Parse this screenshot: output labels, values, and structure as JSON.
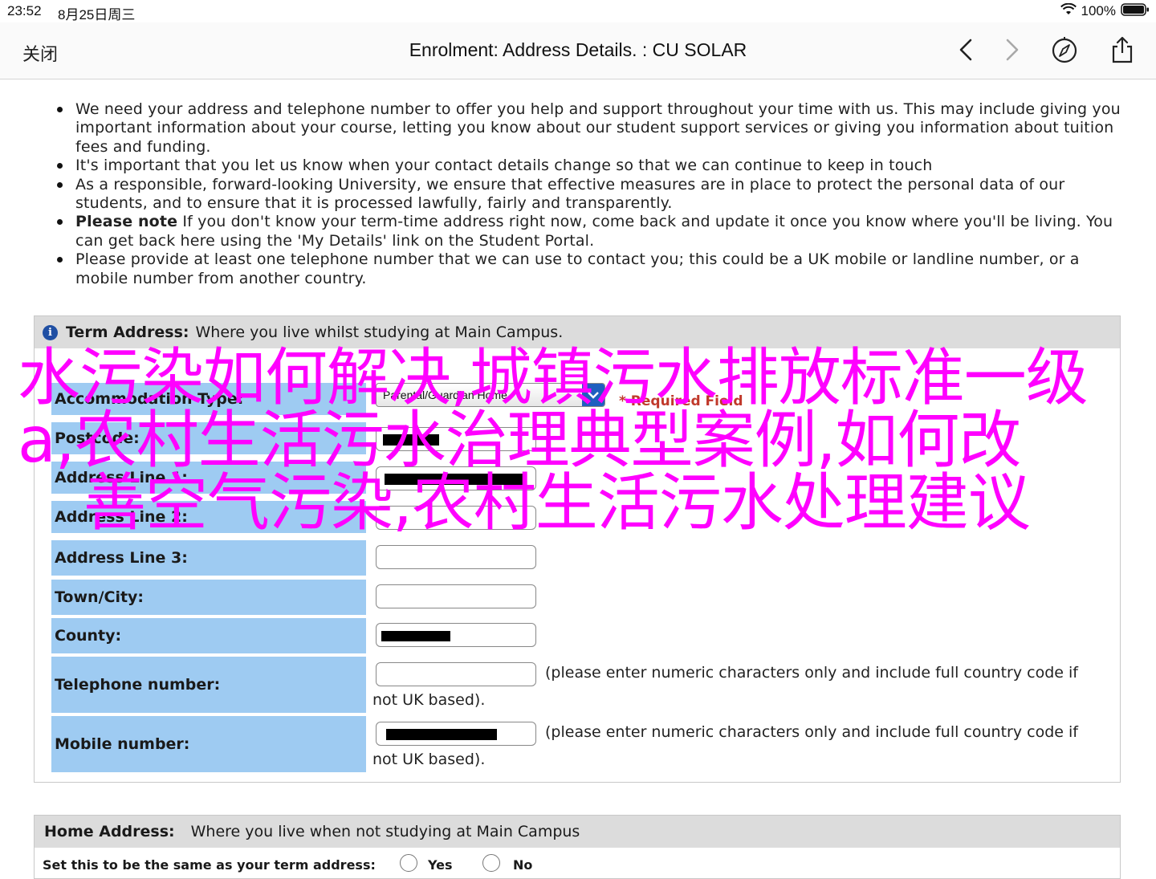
{
  "status_bar": {
    "time": "23:52",
    "date": "8月25日周三",
    "battery": "100%"
  },
  "nav": {
    "close_label": "关闭",
    "title": "Enrolment: Address Details. : CU SOLAR"
  },
  "bullets": [
    {
      "bold": "",
      "text": "We need your address and telephone number to offer you help and support throughout your time with us. This may include giving you important information about your course, letting you know about our student support services or giving you information about tuition fees and funding."
    },
    {
      "bold": "",
      "text": "It's important that you let us know when your contact details change so that we can continue to keep in touch"
    },
    {
      "bold": "",
      "text": "As a responsible, forward-looking University, we ensure that effective measures are in place to protect the personal data of our students, and to ensure that it is processed lawfully, fairly and transparently."
    },
    {
      "bold": "Please note",
      "text": " If you don't know your term-time address right now, come back and update it once you know where you'll be living. You can get back here using the 'My Details' link on the Student Portal."
    },
    {
      "bold": "",
      "text": "Please provide at least one telephone number that we can use to contact you; this could be a UK mobile or landline number, or a mobile number from another country."
    }
  ],
  "term_address": {
    "title": "Term Address:",
    "subtitle": "Where you live whilst studying at Main Campus.",
    "accommodation_label": "Accommodation Type:",
    "accommodation_value": "Parental/Guardian Home",
    "required_text": "* Required Field",
    "postcode_label": "Postcode:",
    "address1_label": "Address Line 1:",
    "address2_label": "Address Line 2:",
    "address3_label": "Address Line 3:",
    "town_label": "Town/City:",
    "county_label": "County:",
    "telephone_label": "Telephone number:",
    "mobile_label": "Mobile number:",
    "phone_hint_line1": "(please enter numeric characters only and include full country code if",
    "phone_hint_line2": "not UK based)."
  },
  "home_address": {
    "title": "Home Address:",
    "subtitle": "Where you live when not studying at Main Campus",
    "same_as_label": "Set this to be the same as your term address:",
    "yes_label": "Yes",
    "no_label": "No"
  },
  "overlay": {
    "line1": "水污染如何解决,城镇污水排放标准一级",
    "line2": "a,农村生活污水治理典型案例,如何改",
    "line3": "善空气污染,农村生活污水处理建议"
  },
  "colors": {
    "label_bg": "#9ecbf2",
    "panel_head_bg": "#dcdcdc",
    "overlay_text": "#ff00ff",
    "required": "#c0392b",
    "select_arrow": "#1f5fbf"
  },
  "icons": [
    "wifi-icon",
    "battery-icon",
    "back-arrow-icon",
    "forward-arrow-icon",
    "compass-icon",
    "share-icon",
    "info-icon"
  ]
}
